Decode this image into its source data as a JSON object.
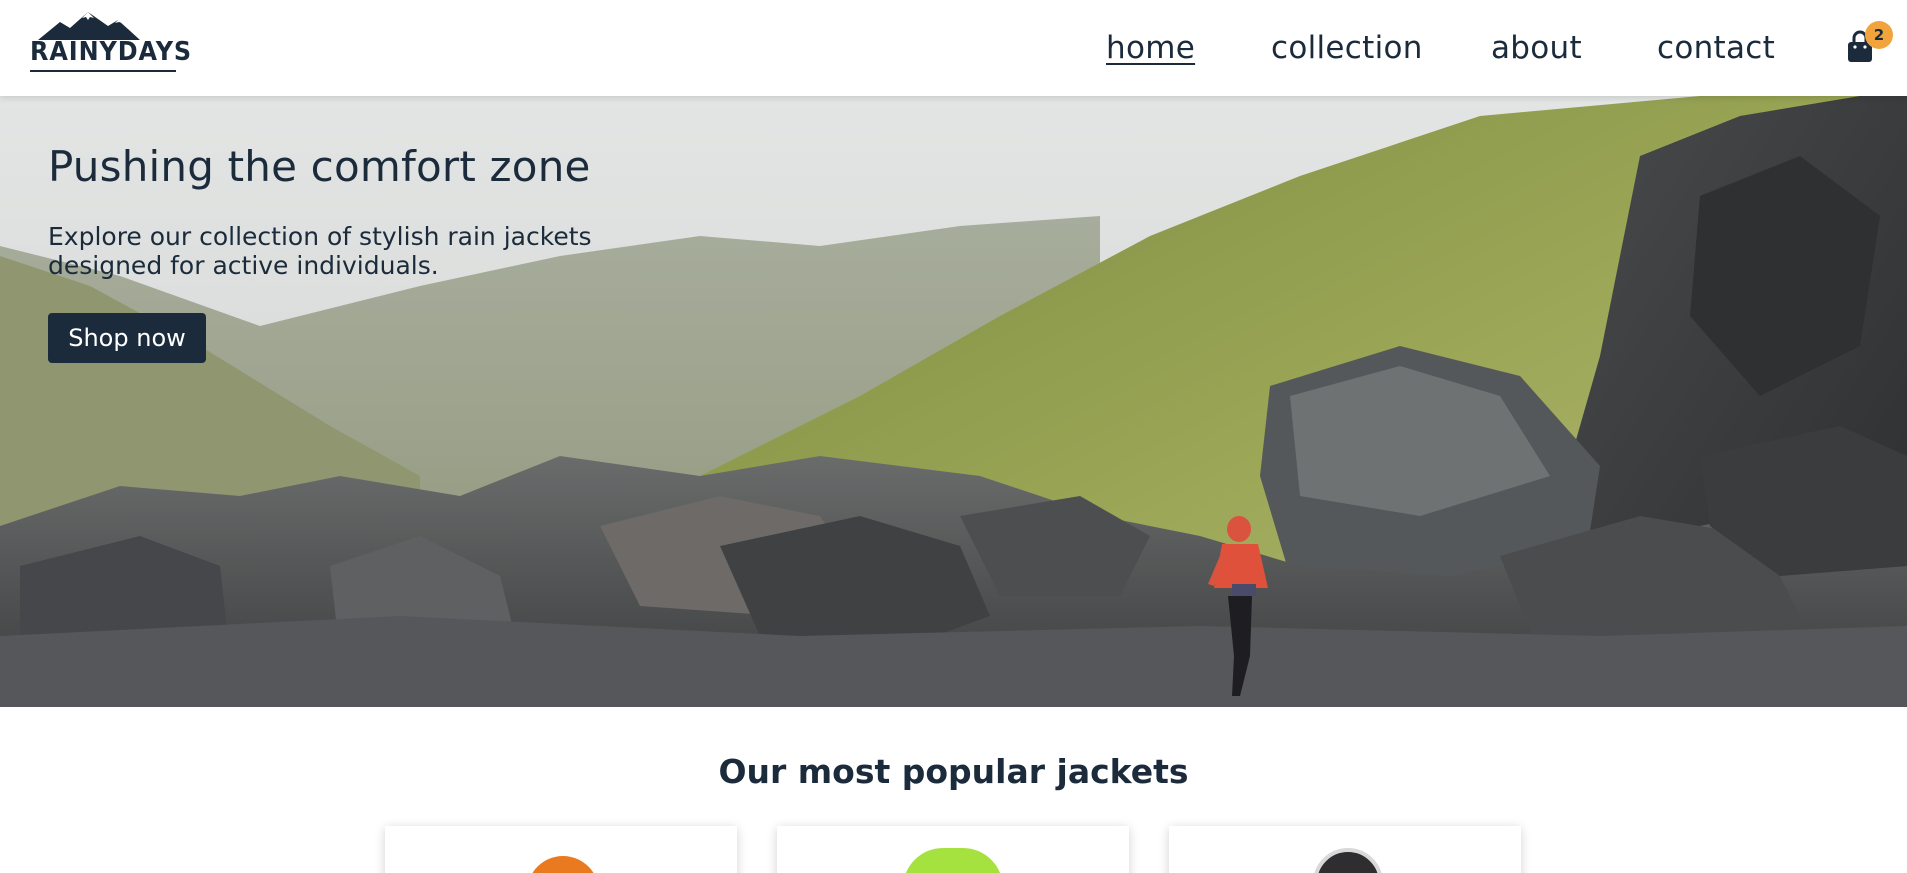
{
  "brand": {
    "logo_text": "RAINYDAYS"
  },
  "nav": {
    "items": [
      {
        "label": "home",
        "active": true
      },
      {
        "label": "collection",
        "active": false
      },
      {
        "label": "about",
        "active": false
      },
      {
        "label": "contact",
        "active": false
      }
    ],
    "cart": {
      "icon": "shopping-bag-icon",
      "count": "2"
    }
  },
  "hero": {
    "title": "Pushing the comfort zone",
    "text": "Explore our collection of stylish rain jackets designed for active individuals.",
    "button_label": "Shop now"
  },
  "popular": {
    "title": "Our most popular jackets",
    "cards": [
      {
        "jacket_color": "#ea7a1f"
      },
      {
        "jacket_color": "#a5e23f"
      },
      {
        "jacket_color": "#3a3a3a"
      }
    ]
  },
  "colors": {
    "primary": "#1b2b3c",
    "badge": "#f2a43c",
    "background": "#ffffff"
  }
}
